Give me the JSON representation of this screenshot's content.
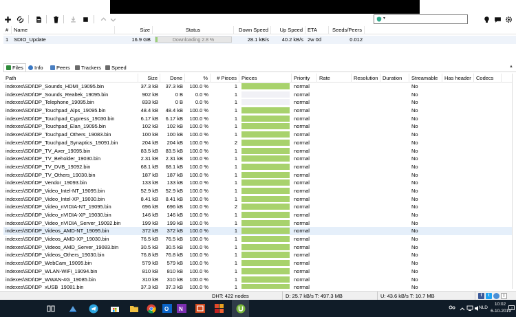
{
  "toolbar": {
    "search_dropdown": "▾",
    "icons": [
      "add-torrent-icon",
      "add-link-icon",
      "create-torrent-icon",
      "remove-icon",
      "download-icon",
      "stop-icon",
      "move-up-icon",
      "move-down-icon",
      "bulb-icon",
      "chat-icon",
      "gear-icon"
    ]
  },
  "torrent_list": {
    "headers": {
      "num": "#",
      "name": "Name",
      "size": "Size",
      "status": "Status",
      "down": "Down Speed",
      "up": "Up Speed",
      "eta": "ETA",
      "peers": "Seeds/Peers"
    },
    "rows": [
      {
        "num": "1",
        "name": "SDIO_Update",
        "size": "16.9 GB",
        "status": "Downloading 2.8 %",
        "progress": 0.028,
        "down": "28.1 kB/s",
        "up": "40.2 kB/s",
        "eta": "2w 0d",
        "peers": "0.012"
      }
    ]
  },
  "tabs": [
    {
      "label": "Files",
      "icon": "files-icon",
      "color": "#2e8b3a",
      "active": true
    },
    {
      "label": "Info",
      "icon": "info-icon",
      "color": "#3a78c4"
    },
    {
      "label": "Peers",
      "icon": "peers-icon",
      "color": "#4a7fc1"
    },
    {
      "label": "Trackers",
      "icon": "trackers-icon",
      "color": "#6b6b6b"
    },
    {
      "label": "Speed",
      "icon": "speed-icon",
      "color": "#6b6b6b"
    }
  ],
  "files_table": {
    "headers": {
      "path": "Path",
      "size": "Size",
      "done": "Done",
      "pct": "%",
      "pieces_count": "# Pieces",
      "pieces": "Pieces",
      "priority": "Priority",
      "rate": "Rate",
      "resolution": "Resolution",
      "duration": "Duration",
      "streamable": "Streamable",
      "has_header": "Has header",
      "codecs": "Codecs"
    },
    "rows": [
      {
        "path": "indexes\\SDI\\DP_Sounds_HDMI_19095.bin",
        "size": "37.3 kB",
        "done": "37.3 kB",
        "pct": "100.0 %",
        "pieces": "1",
        "fill": 1,
        "priority": "normal",
        "streamable": "No"
      },
      {
        "path": "indexes\\SDI\\DP_Sounds_Realtek_19095.bin",
        "size": "902 kB",
        "done": "0 B",
        "pct": "0.0 %",
        "pieces": "1",
        "fill": 0,
        "priority": "normal",
        "streamable": "No"
      },
      {
        "path": "indexes\\SDI\\DP_Telephone_19095.bin",
        "size": "833 kB",
        "done": "0 B",
        "pct": "0.0 %",
        "pieces": "1",
        "fill": 0,
        "priority": "normal",
        "streamable": "No"
      },
      {
        "path": "indexes\\SDI\\DP_Touchpad_Alps_19095.bin",
        "size": "48.4 kB",
        "done": "48.4 kB",
        "pct": "100.0 %",
        "pieces": "1",
        "fill": 1,
        "priority": "normal",
        "streamable": "No"
      },
      {
        "path": "indexes\\SDI\\DP_Touchpad_Cypress_19030.bin",
        "size": "6.17 kB",
        "done": "6.17 kB",
        "pct": "100.0 %",
        "pieces": "1",
        "fill": 1,
        "priority": "normal",
        "streamable": "No"
      },
      {
        "path": "indexes\\SDI\\DP_Touchpad_Elan_19095.bin",
        "size": "102 kB",
        "done": "102 kB",
        "pct": "100.0 %",
        "pieces": "1",
        "fill": 1,
        "priority": "normal",
        "streamable": "No"
      },
      {
        "path": "indexes\\SDI\\DP_Touchpad_Others_19083.bin",
        "size": "100 kB",
        "done": "100 kB",
        "pct": "100.0 %",
        "pieces": "1",
        "fill": 1,
        "priority": "normal",
        "streamable": "No"
      },
      {
        "path": "indexes\\SDI\\DP_Touchpad_Synaptics_19091.bin",
        "size": "204 kB",
        "done": "204 kB",
        "pct": "100.0 %",
        "pieces": "2",
        "fill": 1,
        "priority": "normal",
        "streamable": "No"
      },
      {
        "path": "indexes\\SDI\\DP_TV_Aver_19095.bin",
        "size": "83.5 kB",
        "done": "83.5 kB",
        "pct": "100.0 %",
        "pieces": "1",
        "fill": 1,
        "priority": "normal",
        "streamable": "No"
      },
      {
        "path": "indexes\\SDI\\DP_TV_Beholder_19030.bin",
        "size": "2.31 kB",
        "done": "2.31 kB",
        "pct": "100.0 %",
        "pieces": "1",
        "fill": 1,
        "priority": "normal",
        "streamable": "No"
      },
      {
        "path": "indexes\\SDI\\DP_TV_DVB_19092.bin",
        "size": "68.1 kB",
        "done": "68.1 kB",
        "pct": "100.0 %",
        "pieces": "1",
        "fill": 1,
        "priority": "normal",
        "streamable": "No"
      },
      {
        "path": "indexes\\SDI\\DP_TV_Others_19030.bin",
        "size": "187 kB",
        "done": "187 kB",
        "pct": "100.0 %",
        "pieces": "1",
        "fill": 1,
        "priority": "normal",
        "streamable": "No"
      },
      {
        "path": "indexes\\SDI\\DP_Vendor_19093.bin",
        "size": "133 kB",
        "done": "133 kB",
        "pct": "100.0 %",
        "pieces": "1",
        "fill": 1,
        "priority": "normal",
        "streamable": "No"
      },
      {
        "path": "indexes\\SDI\\DP_Video_Intel-NT_19095.bin",
        "size": "52.9 kB",
        "done": "52.9 kB",
        "pct": "100.0 %",
        "pieces": "1",
        "fill": 1,
        "priority": "normal",
        "streamable": "No"
      },
      {
        "path": "indexes\\SDI\\DP_Video_Intel-XP_19030.bin",
        "size": "8.41 kB",
        "done": "8.41 kB",
        "pct": "100.0 %",
        "pieces": "1",
        "fill": 1,
        "priority": "normal",
        "streamable": "No"
      },
      {
        "path": "indexes\\SDI\\DP_Video_nVIDIA-NT_19095.bin",
        "size": "696 kB",
        "done": "696 kB",
        "pct": "100.0 %",
        "pieces": "2",
        "fill": 1,
        "priority": "normal",
        "streamable": "No"
      },
      {
        "path": "indexes\\SDI\\DP_Video_nVIDIA-XP_19030.bin",
        "size": "146 kB",
        "done": "146 kB",
        "pct": "100.0 %",
        "pieces": "1",
        "fill": 1,
        "priority": "normal",
        "streamable": "No"
      },
      {
        "path": "indexes\\SDI\\DP_Video_nVIDIA_Server_19092.bin",
        "size": "199 kB",
        "done": "199 kB",
        "pct": "100.0 %",
        "pieces": "1",
        "fill": 1,
        "priority": "normal",
        "streamable": "No"
      },
      {
        "path": "indexes\\SDI\\DP_Videos_AMD-NT_19095.bin",
        "size": "372 kB",
        "done": "372 kB",
        "pct": "100.0 %",
        "pieces": "1",
        "fill": 1,
        "priority": "normal",
        "streamable": "No",
        "selected": true
      },
      {
        "path": "indexes\\SDI\\DP_Videos_AMD-XP_19030.bin",
        "size": "76.5 kB",
        "done": "76.5 kB",
        "pct": "100.0 %",
        "pieces": "1",
        "fill": 1,
        "priority": "normal",
        "streamable": "No"
      },
      {
        "path": "indexes\\SDI\\DP_Videos_AMD_Server_19083.bin",
        "size": "30.5 kB",
        "done": "30.5 kB",
        "pct": "100.0 %",
        "pieces": "1",
        "fill": 1,
        "priority": "normal",
        "streamable": "No"
      },
      {
        "path": "indexes\\SDI\\DP_Videos_Others_19030.bin",
        "size": "76.8 kB",
        "done": "76.8 kB",
        "pct": "100.0 %",
        "pieces": "1",
        "fill": 1,
        "priority": "normal",
        "streamable": "No"
      },
      {
        "path": "indexes\\SDI\\DP_WebCam_19095.bin",
        "size": "579 kB",
        "done": "579 kB",
        "pct": "100.0 %",
        "pieces": "1",
        "fill": 1,
        "priority": "normal",
        "streamable": "No"
      },
      {
        "path": "indexes\\SDI\\DP_WLAN-WiFi_19094.bin",
        "size": "810 kB",
        "done": "810 kB",
        "pct": "100.0 %",
        "pieces": "1",
        "fill": 1,
        "priority": "normal",
        "streamable": "No"
      },
      {
        "path": "indexes\\SDI\\DP_WWAN-4G_19085.bin",
        "size": "310 kB",
        "done": "310 kB",
        "pct": "100.0 %",
        "pieces": "1",
        "fill": 1,
        "priority": "normal",
        "streamable": "No"
      },
      {
        "path": "indexes\\SDI\\DP_xUSB_19081.bin",
        "size": "37.3 kB",
        "done": "37.3 kB",
        "pct": "100.0 %",
        "pieces": "1",
        "fill": 1,
        "priority": "normal",
        "streamable": "No"
      }
    ]
  },
  "statusbar": {
    "dht": "DHT: 422 nodes",
    "down": "D: 25.7 kB/s T: 497.3 MB",
    "up": "U: 43.6 kB/s T: 10.7 MB",
    "social_icons": [
      "facebook-icon",
      "twitter-icon",
      "web-icon"
    ]
  },
  "taskbar": {
    "apps": [
      "task-view-icon",
      "cloud-app-icon",
      "telegram-icon",
      "store-icon",
      "folder-icon",
      "chrome-icon",
      "outlook-icon",
      "onenote-icon",
      "office-icon",
      "utorrent-icon"
    ],
    "language": "NLD",
    "time": "10:02",
    "date": "6-10-2019"
  },
  "colors": {
    "pieces_green": "#a8d26c",
    "progress_green": "#9ad07a",
    "selected_row": "#e5effa",
    "taskbar": "#101c28"
  }
}
